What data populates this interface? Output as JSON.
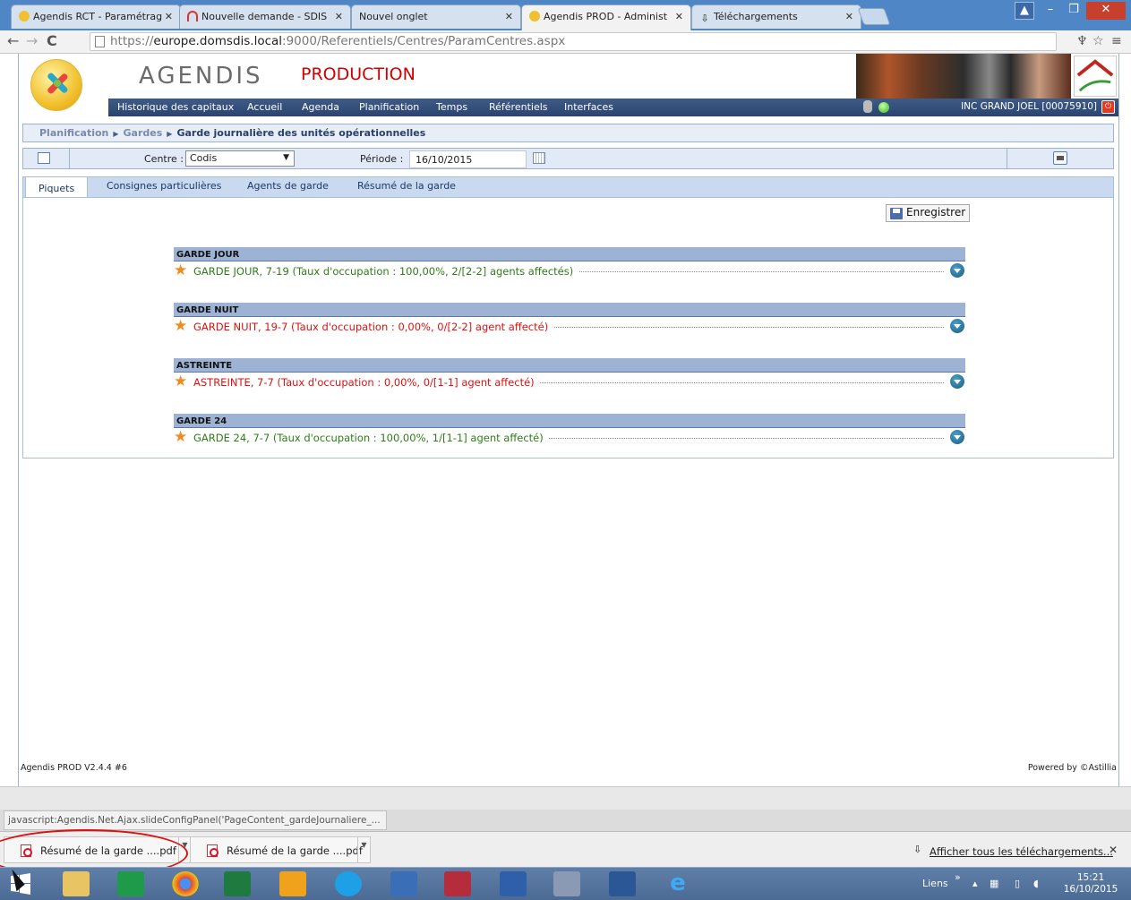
{
  "browser": {
    "tabs": [
      {
        "title": "Agendis RCT - Paramétrag",
        "active": false
      },
      {
        "title": "Nouvelle demande - SDIS",
        "active": false
      },
      {
        "title": "Nouvel onglet",
        "active": false
      },
      {
        "title": "Agendis PROD - Administ",
        "active": true
      },
      {
        "title": "Téléchargements",
        "active": false
      }
    ],
    "url_prefix": "https://",
    "url_host": "europe.domsdis.local",
    "url_rest": ":9000/Referentiels/Centres/ParamCentres.aspx",
    "status_url": "javascript:Agendis.Net.Ajax.slideConfigPanel('PageContent_gardeJournaliere_..."
  },
  "app": {
    "brand": "AGENDIS",
    "env": "PRODUCTION",
    "menu": [
      "Historique des capitaux",
      "Accueil",
      "Agenda",
      "Planification",
      "Temps",
      "Référentiels",
      "Interfaces"
    ],
    "user": "INC GRAND JOEL [00075910]",
    "breadcrumb": {
      "level1": "Planification",
      "level2": "Gardes",
      "current": "Garde journalière des unités opérationnelles"
    },
    "filters": {
      "centre_label": "Centre :",
      "centre_value": "Codis",
      "periode_label": "Période :",
      "periode_value": "16/10/2015"
    },
    "page_tabs": [
      "Piquets",
      "Consignes particulières",
      "Agents de garde",
      "Résumé de la garde"
    ],
    "save_label": "Enregistrer",
    "shifts": [
      {
        "header": "GARDE JOUR",
        "line": "GARDE JOUR, 7-19 (Taux d'occupation : 100,00%, 2/[2-2] agents affectés)",
        "status": "ok"
      },
      {
        "header": "GARDE NUIT",
        "line": "GARDE NUIT, 19-7 (Taux d'occupation : 0,00%, 0/[2-2] agent affecté)",
        "status": "bad"
      },
      {
        "header": "ASTREINTE",
        "line": "ASTREINTE, 7-7 (Taux d'occupation : 0,00%, 0/[1-1] agent affecté)",
        "status": "bad"
      },
      {
        "header": "GARDE 24",
        "line": "GARDE 24, 7-7 (Taux d'occupation : 100,00%, 1/[1-1] agent affecté)",
        "status": "ok"
      }
    ],
    "footer_version": "Agendis PROD V2.4.4 #6",
    "footer_powered": "Powered by ©Astillia"
  },
  "downloads": {
    "items": [
      "Résumé de la garde ....pdf",
      "Résumé de la garde ....pdf"
    ],
    "show_all": "Afficher tous les téléchargements..."
  },
  "taskbar": {
    "links_label": "Liens",
    "time": "15:21",
    "date": "16/10/2015"
  },
  "colors": {
    "ok": "#2e7d18",
    "bad": "#e01010",
    "menubar": "#2b4470"
  }
}
